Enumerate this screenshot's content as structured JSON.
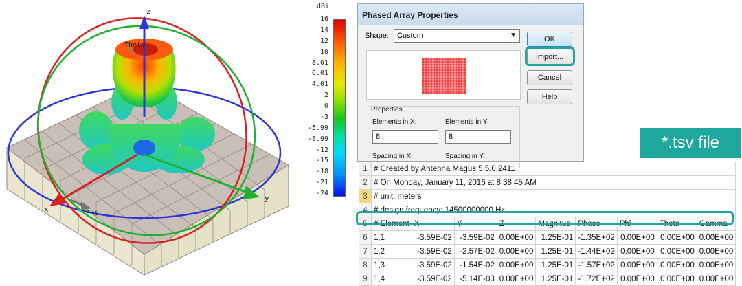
{
  "plot3d": {
    "axis_z": "z",
    "axis_x": "x",
    "axis_y": "y",
    "theta_label": "Theta",
    "phi_label": "Phi"
  },
  "colorbar": {
    "title": "dBi",
    "ticks": [
      "16",
      "14",
      "12",
      "10",
      "8.01",
      "6.01",
      "4.01",
      "2",
      "0",
      "-3",
      "-5.99",
      "-8.99",
      "-12",
      "-15",
      "-18",
      "-21",
      "-24"
    ]
  },
  "dialog": {
    "title": "Phased Array Properties",
    "shape_label": "Shape:",
    "shape_value": "Custom",
    "buttons": {
      "ok": "OK",
      "import": "Import...",
      "cancel": "Cancel",
      "help": "Help"
    },
    "properties_label": "Properties",
    "elements_x_label": "Elements in X:",
    "elements_y_label": "Elements in Y:",
    "elements_x_value": "8",
    "elements_y_value": "8",
    "spacing_x_label": "Spacing in X:",
    "spacing_y_label": "Spacing in Y:"
  },
  "banner": "*.tsv file",
  "sheet": {
    "rows": [
      {
        "n": "1",
        "cells": [
          "# Created by Antenna Magus 5.5.0.2411"
        ]
      },
      {
        "n": "2",
        "cells": [
          "# On Monday, January 11, 2016 at 8:38:45 AM"
        ]
      },
      {
        "n": "3",
        "cells": [
          "# unit: meters"
        ]
      },
      {
        "n": "4",
        "cells": [
          "# design frequency: 14500000000 Hz"
        ]
      },
      {
        "n": "5",
        "cells": [
          "# Element",
          "X",
          "Y",
          "Z",
          "Magnitud",
          "Phase",
          "Phi",
          "Theta",
          "Gamma"
        ]
      },
      {
        "n": "6",
        "cells": [
          "1,1",
          "-3.59E-02",
          "-3.59E-02",
          "0.00E+00",
          "1.25E-01",
          "-1.35E+02",
          "0.00E+00",
          "0.00E+00",
          "0.00E+00"
        ]
      },
      {
        "n": "7",
        "cells": [
          "1,2",
          "-3.59E-02",
          "-2.57E-02",
          "0.00E+00",
          "1.25E-01",
          "-1.44E+02",
          "0.00E+00",
          "0.00E+00",
          "0.00E+00"
        ]
      },
      {
        "n": "8",
        "cells": [
          "1,3",
          "-3.59E-02",
          "-1.54E-02",
          "0.00E+00",
          "1.25E-01",
          "-1.57E+02",
          "0.00E+00",
          "0.00E+00",
          "0.00E+00"
        ]
      },
      {
        "n": "9",
        "cells": [
          "1,4",
          "-3.59E-02",
          "-5.14E-03",
          "0.00E+00",
          "1.25E-01",
          "-1.72E+02",
          "0.00E+00",
          "0.00E+00",
          "0.00E+00"
        ]
      }
    ]
  }
}
